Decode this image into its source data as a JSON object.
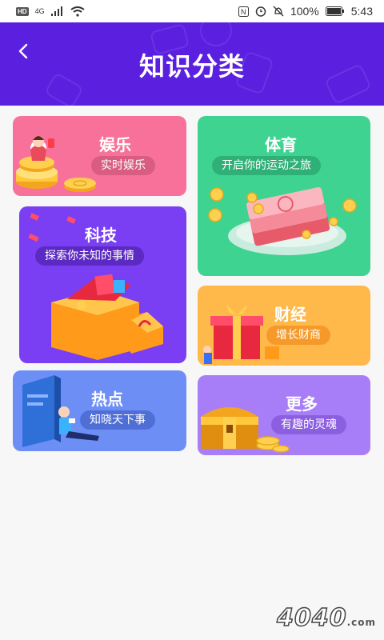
{
  "status_bar": {
    "network_badge": "HD",
    "network_type": "4G",
    "battery": "100%",
    "time": "5:43"
  },
  "header": {
    "title": "知识分类",
    "background_color": "#5b1fe0"
  },
  "categories": [
    {
      "title": "娱乐",
      "subtitle": "实时娱乐",
      "color": "#f8719a"
    },
    {
      "title": "体育",
      "subtitle": "开启你的运动之旅",
      "color": "#3fd391"
    },
    {
      "title": "科技",
      "subtitle": "探索你未知的事情",
      "color": "#7a3ff3"
    },
    {
      "title": "财经",
      "subtitle": "增长财商",
      "color": "#ffb84a"
    },
    {
      "title": "热点",
      "subtitle": "知晓天下事",
      "color": "#6d8ff5"
    },
    {
      "title": "更多",
      "subtitle": "有趣的灵魂",
      "color": "#a77ef7"
    }
  ],
  "watermark": {
    "logo_text": "4040",
    "domain": ".com"
  }
}
